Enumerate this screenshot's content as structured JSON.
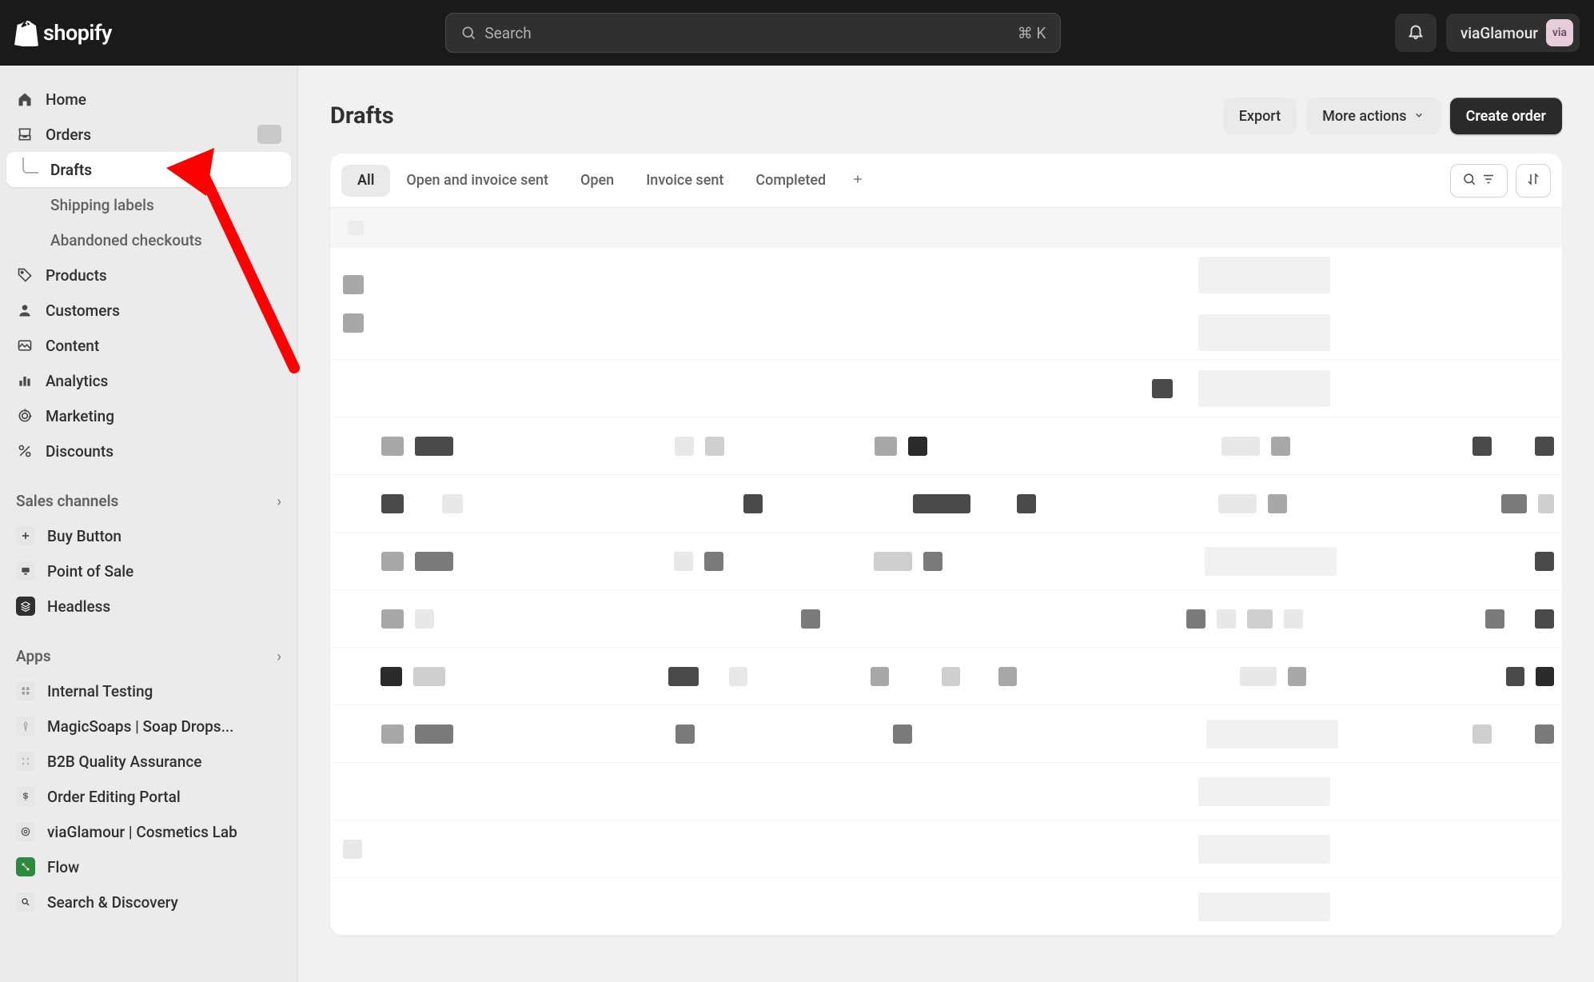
{
  "brand": {
    "name": "shopify"
  },
  "topbar": {
    "search_placeholder": "Search",
    "search_shortcut": "⌘ K",
    "store_name": "viaGlamour",
    "store_badge": "via"
  },
  "sidebar": {
    "main": [
      {
        "label": "Home"
      },
      {
        "label": "Orders",
        "has_badge": true
      },
      {
        "label": "Products"
      },
      {
        "label": "Customers"
      },
      {
        "label": "Content"
      },
      {
        "label": "Analytics"
      },
      {
        "label": "Marketing"
      },
      {
        "label": "Discounts"
      }
    ],
    "orders_sub": [
      {
        "label": "Drafts",
        "active": true
      },
      {
        "label": "Shipping labels"
      },
      {
        "label": "Abandoned checkouts"
      }
    ],
    "sections": {
      "sales_channels": "Sales channels",
      "apps": "Apps"
    },
    "channels": [
      {
        "label": "Buy Button"
      },
      {
        "label": "Point of Sale"
      },
      {
        "label": "Headless"
      }
    ],
    "apps": [
      {
        "label": "Internal Testing"
      },
      {
        "label": "MagicSoaps | Soap Drops..."
      },
      {
        "label": "B2B Quality Assurance"
      },
      {
        "label": "Order Editing Portal"
      },
      {
        "label": "viaGlamour | Cosmetics Lab"
      },
      {
        "label": "Flow"
      },
      {
        "label": "Search & Discovery"
      }
    ]
  },
  "page": {
    "title": "Drafts",
    "actions": {
      "export": "Export",
      "more": "More actions",
      "create": "Create order"
    }
  },
  "tabs": [
    {
      "label": "All",
      "active": true
    },
    {
      "label": "Open and invoice sent"
    },
    {
      "label": "Open"
    },
    {
      "label": "Invoice sent"
    },
    {
      "label": "Completed"
    }
  ]
}
